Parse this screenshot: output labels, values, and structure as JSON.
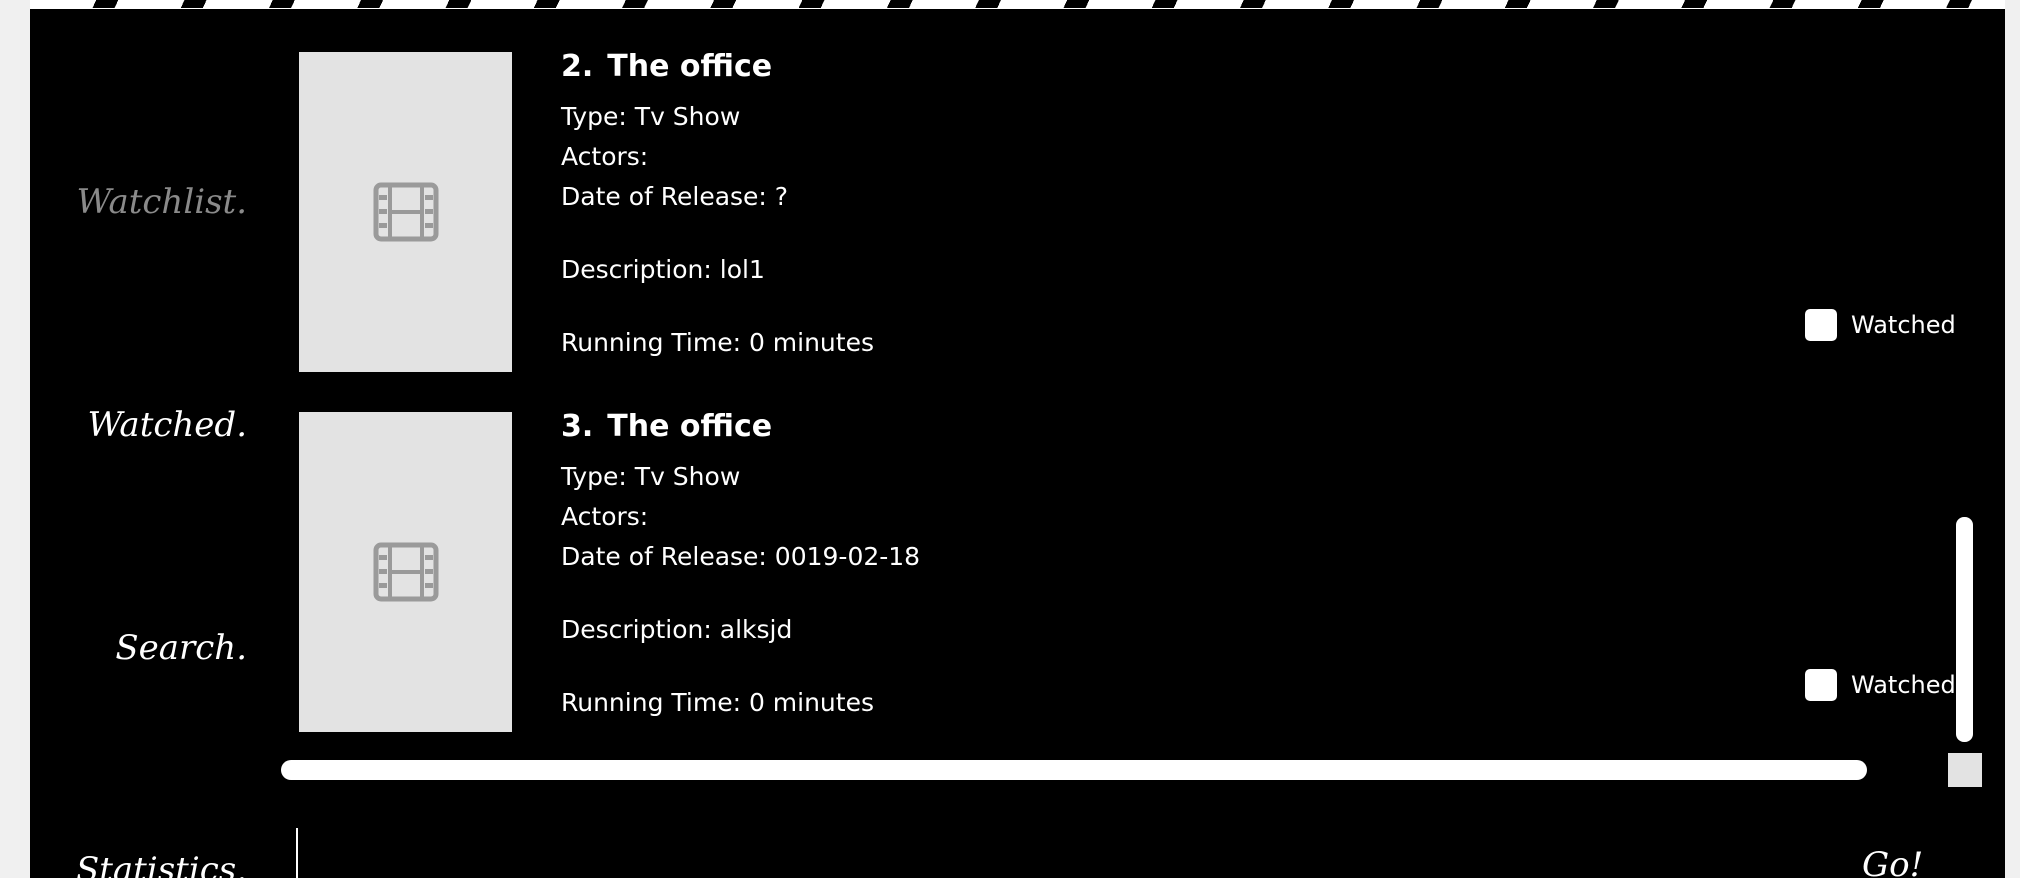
{
  "nav": {
    "watchlist": "Watchlist.",
    "watched": "Watched.",
    "search": "Search.",
    "statistics": "Statistics."
  },
  "items": [
    {
      "number": "2.",
      "title": "The office",
      "type": "Type: Tv Show",
      "actors": "Actors:",
      "release": "Date of Release: ?",
      "description": "Description: lol1",
      "running_time": "Running Time: 0 minutes",
      "watched_label": "Watched",
      "thumbnail_icon": "film-icon"
    },
    {
      "number": "3.",
      "title": "The office",
      "type": "Type: Tv Show",
      "actors": "Actors:",
      "release": "Date of Release: 0019-02-18",
      "description": "Description: alksjd",
      "running_time": "Running Time: 0 minutes",
      "watched_label": "Watched",
      "thumbnail_icon": "film-icon"
    }
  ],
  "search": {
    "go_label": "Go!"
  },
  "colors": {
    "background": "#000000",
    "text": "#ffffff",
    "inactive_nav": "#8a8a8a",
    "thumbnail": "#e3e3e3"
  }
}
